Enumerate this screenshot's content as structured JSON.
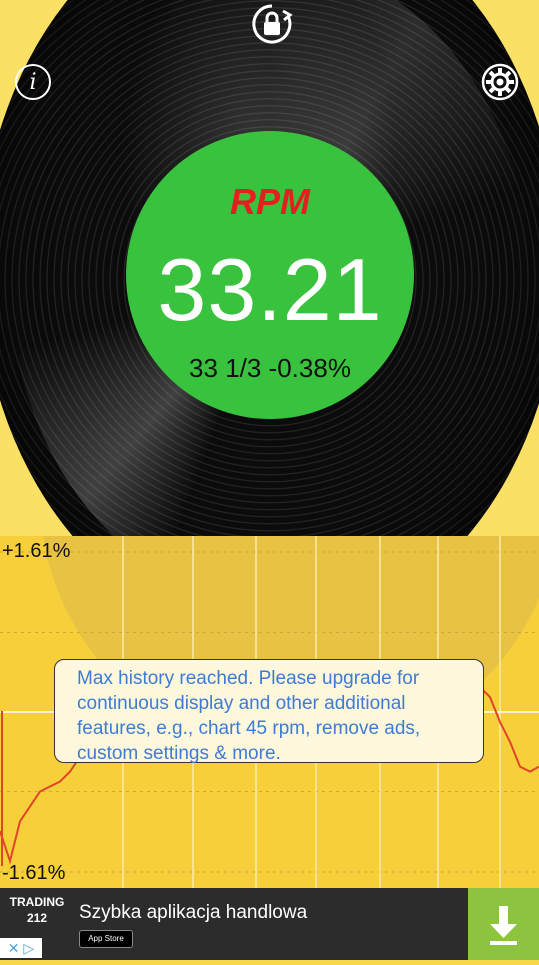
{
  "header": {
    "info_icon_glyph": "i",
    "lock_icon": "rotation-lock-icon",
    "settings_icon": "gear-icon"
  },
  "gauge": {
    "title": "RPM",
    "value": "33.21",
    "subtitle": "33 1/3 -0.38%"
  },
  "chart": {
    "y_max_label": "+1.61%",
    "y_min_label": "-1.61%",
    "notice": "Max history reached.  Please upgrade for continuous display and other additional features, e.g., chart 45 rpm, remove ads, custom settings & more."
  },
  "chart_data": {
    "type": "line",
    "title": "",
    "xlabel": "",
    "ylabel": "",
    "ylim": [
      -1.61,
      1.61
    ],
    "x": [
      0,
      10,
      20,
      30,
      40,
      50,
      60,
      70,
      80,
      90,
      100,
      110,
      120,
      130,
      140,
      150,
      340,
      350,
      360,
      370,
      380,
      390,
      480,
      490,
      500,
      510,
      520,
      530,
      539
    ],
    "series": [
      {
        "values": [
          -1.2,
          -1.5,
          -1.1,
          -0.95,
          -0.8,
          -0.75,
          -0.7,
          -0.6,
          -0.45,
          -0.3,
          -0.2,
          -0.1,
          0.0,
          0.05,
          0.12,
          0.15,
          0.22,
          0.15,
          0.1,
          0.08,
          0.1,
          0.18,
          0.25,
          0.15,
          -0.1,
          -0.3,
          -0.55,
          -0.6,
          -0.55
        ]
      }
    ],
    "grid": true
  },
  "ad": {
    "logo_line1": "TRADING",
    "logo_line2": "212",
    "text": "Szybka aplikacja handlowa",
    "store_badge": "App Store",
    "close_glyph": "✕ ▷",
    "download_icon": "download-icon"
  },
  "colors": {
    "label_green": "#39c23e",
    "rpm_red": "#e41f1f",
    "chart_line": "#e0442a",
    "notice_text": "#3f7bd4",
    "download_green": "#8dc43f"
  }
}
